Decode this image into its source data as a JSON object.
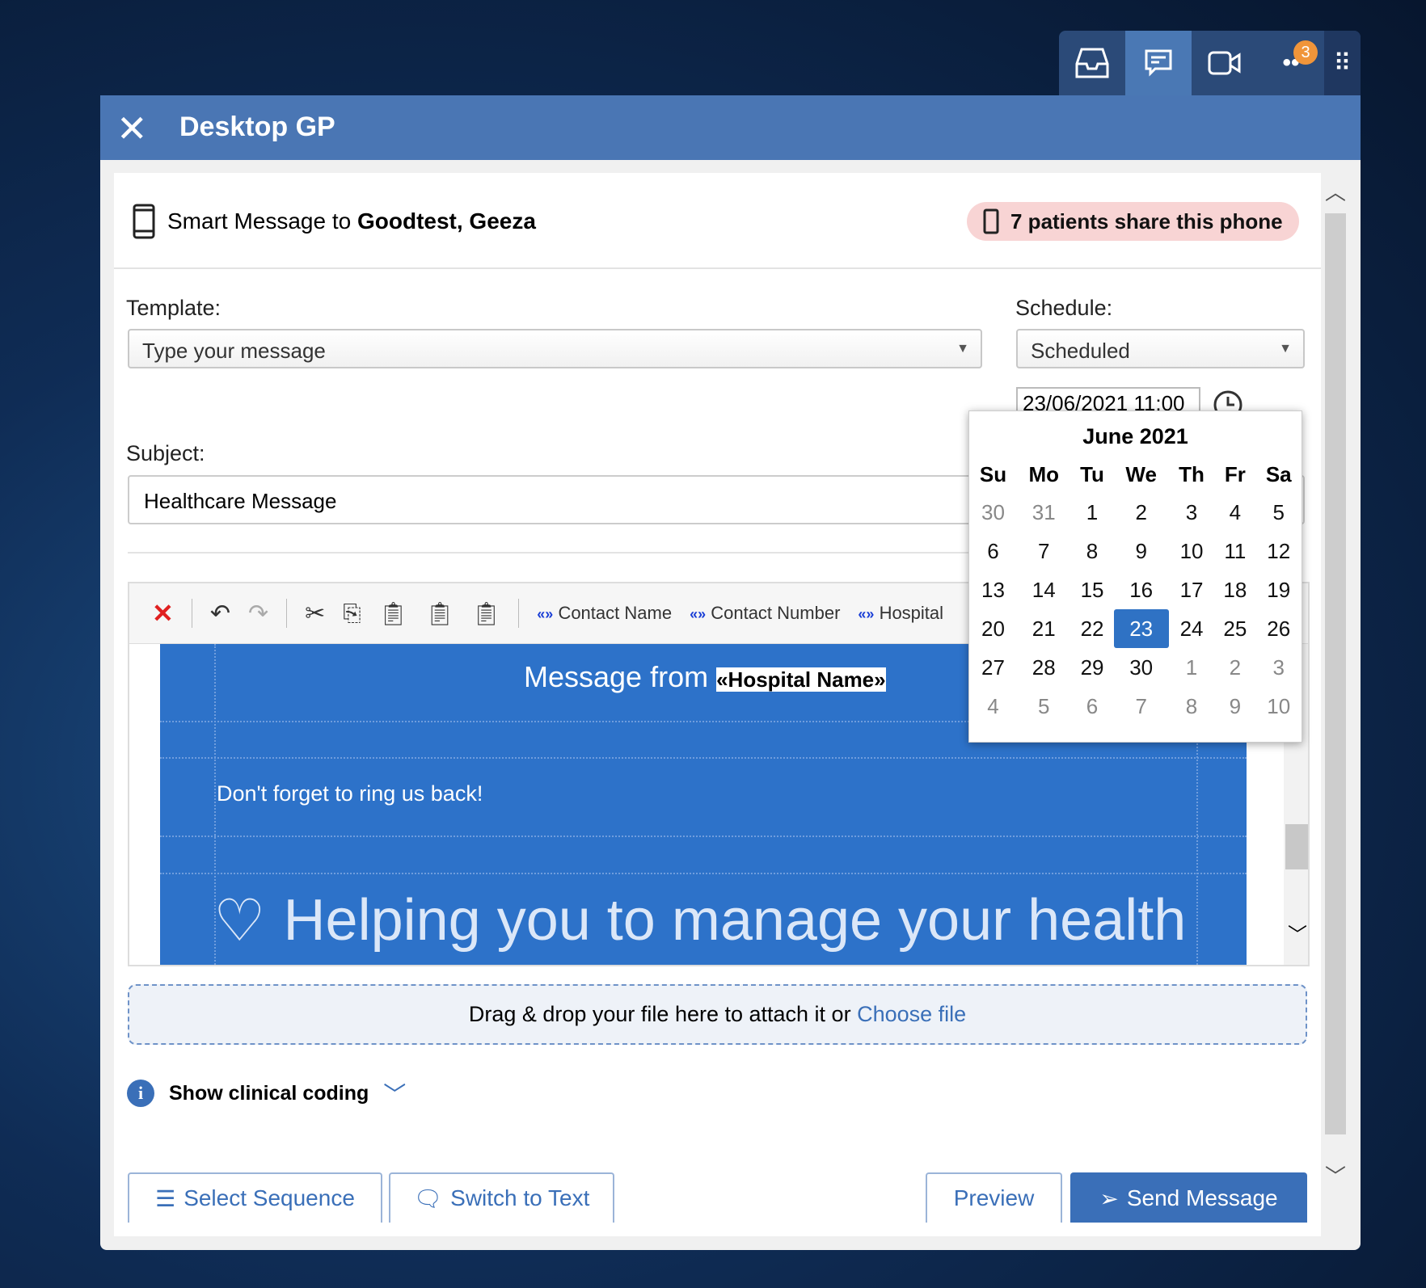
{
  "topbar": {
    "items": [
      {
        "icon": "inbox-icon"
      },
      {
        "icon": "chat-icon",
        "active": true
      },
      {
        "icon": "video-icon"
      },
      {
        "icon": "more-icon",
        "badge": "3"
      }
    ],
    "grip_icon": "drag-grip-icon"
  },
  "window": {
    "title": "Desktop GP",
    "close_icon": "close-icon"
  },
  "message": {
    "prefix": "Smart Message to ",
    "recipient": "Goodtest, Geeza",
    "shared_phone_warning": "7 patients share this phone"
  },
  "template": {
    "label": "Template:",
    "value": "Type your message"
  },
  "schedule": {
    "label": "Schedule:",
    "value": "Scheduled",
    "datetime": "23/06/2021 11:00"
  },
  "subject": {
    "label": "Subject:",
    "value": "Healthcare Message"
  },
  "calendar": {
    "month": "June 2021",
    "weekdays": [
      "Su",
      "Mo",
      "Tu",
      "We",
      "Th",
      "Fr",
      "Sa"
    ],
    "weeks": [
      [
        "30",
        "31",
        "1",
        "2",
        "3",
        "4",
        "5"
      ],
      [
        "6",
        "7",
        "8",
        "9",
        "10",
        "11",
        "12"
      ],
      [
        "13",
        "14",
        "15",
        "16",
        "17",
        "18",
        "19"
      ],
      [
        "20",
        "21",
        "22",
        "23",
        "24",
        "25",
        "26"
      ],
      [
        "27",
        "28",
        "29",
        "30",
        "1",
        "2",
        "3"
      ],
      [
        "4",
        "5",
        "6",
        "7",
        "8",
        "9",
        "10"
      ]
    ],
    "selected": "23",
    "accent": "#2f72c4"
  },
  "editor": {
    "merge_fields": [
      "Contact Name",
      "Contact Number",
      "Hospital"
    ],
    "merge_marker": "«»",
    "heading_prefix": "Message from ",
    "heading_field": "«Hospital Name»",
    "body": "Don't forget to ring us back!",
    "banner": "Helping you to manage your health",
    "bg_color": "#2d72c9"
  },
  "attach": {
    "text": "Drag & drop your file here to attach it or ",
    "link": "Choose file"
  },
  "clinical": {
    "label": "Show clinical coding"
  },
  "buttons": {
    "select_sequence": "Select Sequence",
    "switch_to_text": "Switch to Text",
    "preview": "Preview",
    "send": "Send Message"
  }
}
